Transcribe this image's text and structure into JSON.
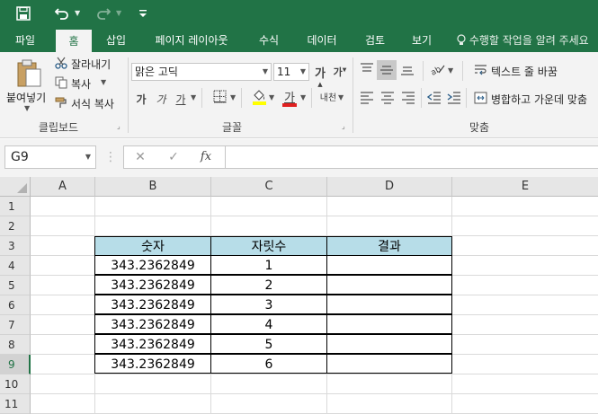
{
  "quick_access": {
    "save_icon": "save-icon",
    "undo_icon": "undo-icon",
    "redo_icon": "redo-icon",
    "customize_icon": "customize-qat-icon"
  },
  "tabs": [
    {
      "label": "파일"
    },
    {
      "label": "홈"
    },
    {
      "label": "삽입"
    },
    {
      "label": "페이지 레이아웃"
    },
    {
      "label": "수식"
    },
    {
      "label": "데이터"
    },
    {
      "label": "검토"
    },
    {
      "label": "보기"
    }
  ],
  "active_tab": "홈",
  "tell_me": "수행할 작업을 알려 주세요",
  "ribbon": {
    "clipboard": {
      "paste_label": "붙여넣기",
      "cut_label": "잘라내기",
      "copy_label": "복사",
      "format_painter_label": "서식 복사",
      "group_label": "클립보드"
    },
    "font": {
      "font_name": "맑은 고딕",
      "font_size": "11",
      "bold": "가",
      "italic": "가",
      "underline": "가",
      "grow": "가",
      "shrink": "가",
      "font_color_glyph": "가",
      "phonetic": "내천",
      "group_label": "글꼴"
    },
    "alignment": {
      "wrap_text_label": "텍스트 줄 바꿈",
      "merge_center_label": "병합하고 가운데 맞춤",
      "group_label": "맞춤"
    }
  },
  "formula_bar": {
    "name_box": "G9",
    "formula": "",
    "fx_label": "fx"
  },
  "columns": [
    "A",
    "B",
    "C",
    "D",
    "E"
  ],
  "rows": [
    "1",
    "2",
    "3",
    "4",
    "5",
    "6",
    "7",
    "8",
    "9",
    "10",
    "11"
  ],
  "selected_row": "9",
  "table": {
    "headers": [
      "숫자",
      "자릿수",
      "결과"
    ],
    "rows": [
      {
        "number": "343.2362849",
        "digits": "1",
        "result": ""
      },
      {
        "number": "343.2362849",
        "digits": "2",
        "result": ""
      },
      {
        "number": "343.2362849",
        "digits": "3",
        "result": ""
      },
      {
        "number": "343.2362849",
        "digits": "4",
        "result": ""
      },
      {
        "number": "343.2362849",
        "digits": "5",
        "result": ""
      },
      {
        "number": "343.2362849",
        "digits": "6",
        "result": ""
      }
    ]
  },
  "colors": {
    "accent": "#217346",
    "header_fill": "#b7dde8"
  }
}
